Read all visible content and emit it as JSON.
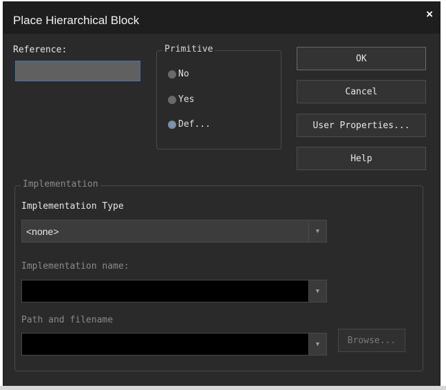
{
  "window": {
    "title": "Place Hierarchical Block",
    "close_glyph": "×"
  },
  "reference": {
    "label": "Reference:",
    "value": ""
  },
  "primitive": {
    "legend": "Primitive",
    "options": [
      {
        "label": "No",
        "selected": false
      },
      {
        "label": "Yes",
        "selected": false
      },
      {
        "label": "Def...",
        "selected": true
      }
    ]
  },
  "buttons": {
    "ok": "OK",
    "cancel": "Cancel",
    "user_properties": "User Properties...",
    "help": "Help"
  },
  "implementation": {
    "legend": "Implementation",
    "type_label": "Implementation Type",
    "type_value": "<none>",
    "name_label": "Implementation name:",
    "name_value": "",
    "path_label": "Path and filename",
    "path_value": "",
    "browse": "Browse..."
  },
  "icons": {
    "dropdown": "▼"
  },
  "colors": {
    "accent": "#4aa3f0",
    "dialog_bg": "#2a2a2a",
    "titlebar_bg": "#1e1e1e"
  }
}
